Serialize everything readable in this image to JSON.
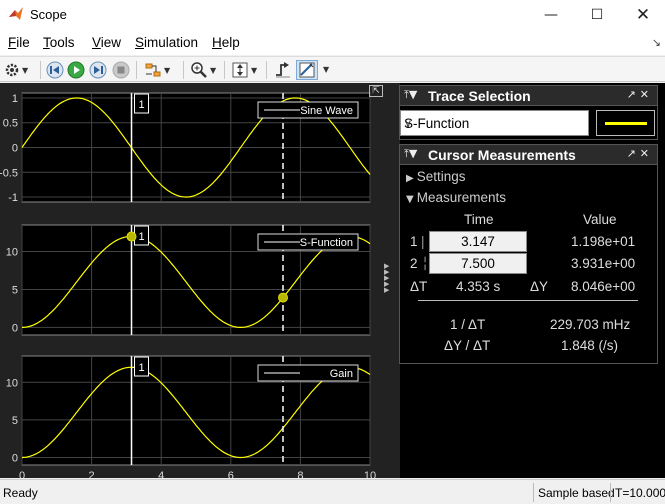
{
  "window": {
    "title": "Scope",
    "controls": [
      "minimize-icon",
      "maximize-icon",
      "close-icon"
    ]
  },
  "menu": {
    "items": [
      {
        "label": "File",
        "mnemonic": "F"
      },
      {
        "label": "Tools",
        "mnemonic": "T"
      },
      {
        "label": "View",
        "mnemonic": "V"
      },
      {
        "label": "Simulation",
        "mnemonic": "S"
      },
      {
        "label": "Help",
        "mnemonic": "H"
      }
    ]
  },
  "toolbar": {
    "buttons": [
      "settings-icon",
      "step-back-icon",
      "run-icon",
      "step-forward-icon",
      "stop-icon",
      "highlight-simulink-icon",
      "zoom-icon",
      "scale-axes-icon",
      "triggers-icon",
      "cursor-measurements-icon"
    ]
  },
  "plots": {
    "x_ticks": [
      "0",
      "2",
      "4",
      "6",
      "8",
      "10"
    ],
    "cursor1_label": "1",
    "panes": [
      {
        "legend": "Sine Wave",
        "y_ticks": [
          "1",
          "0.5",
          "0",
          "-0.5",
          "-1"
        ]
      },
      {
        "legend": "S-Function",
        "y_ticks": [
          "10",
          "5",
          "0"
        ]
      },
      {
        "legend": "Gain",
        "y_ticks": [
          "10",
          "5",
          "0"
        ]
      }
    ],
    "colors": {
      "trace": "#ffff00",
      "grid": "#444444",
      "axes_bg": "#000000",
      "figure_bg": "#222222"
    }
  },
  "chart_data": [
    {
      "type": "line",
      "title": "",
      "xlabel": "",
      "ylabel": "",
      "xlim": [
        0,
        10
      ],
      "ylim": [
        -1.1,
        1.1
      ],
      "series": [
        {
          "name": "Sine Wave",
          "function": "sin(t)",
          "x": [
            0,
            1.571,
            3.142,
            4.712,
            6.283,
            7.854,
            9.425,
            10
          ],
          "y": [
            0,
            1,
            0,
            -1,
            0,
            1,
            0,
            -0.544
          ]
        }
      ],
      "cursors": [
        3.147,
        7.5
      ]
    },
    {
      "type": "line",
      "title": "",
      "xlabel": "",
      "ylabel": "",
      "xlim": [
        0,
        10
      ],
      "ylim": [
        -1,
        13.5
      ],
      "series": [
        {
          "name": "S-Function",
          "function": "6*(1-cos(t))",
          "x": [
            0,
            1.571,
            3.142,
            4.712,
            6.283,
            7.854,
            9.425,
            10
          ],
          "y": [
            0,
            6,
            12,
            6,
            0,
            6,
            12,
            11.03
          ]
        }
      ],
      "cursors": [
        3.147,
        7.5
      ],
      "markers": [
        {
          "x": 3.147,
          "y": 11.98
        },
        {
          "x": 7.5,
          "y": 3.931
        }
      ]
    },
    {
      "type": "line",
      "title": "",
      "xlabel": "",
      "ylabel": "",
      "xlim": [
        0,
        10
      ],
      "ylim": [
        -1,
        13.5
      ],
      "series": [
        {
          "name": "Gain",
          "function": "6*(1-cos(t))",
          "x": [
            0,
            1.571,
            3.142,
            4.712,
            6.283,
            7.854,
            9.425,
            10
          ],
          "y": [
            0,
            6,
            12,
            6,
            0,
            6,
            12,
            11.03
          ]
        }
      ],
      "cursors": [
        3.147,
        7.5
      ]
    }
  ],
  "trace_selection": {
    "title": "Trace Selection",
    "selected": "S-Function",
    "swatch_color": "#ffff00"
  },
  "cursor_measurements": {
    "title": "Cursor Measurements",
    "settings_label": "Settings",
    "measurements_label": "Measurements",
    "col_time": "Time",
    "col_value": "Value",
    "row1_label": "1",
    "row1_time": "3.147",
    "row1_value": "1.198e+01",
    "row2_label": "2",
    "row2_time": "7.500",
    "row2_value": "3.931e+00",
    "dt_label": "ΔT",
    "dt_value": "4.353 s",
    "dy_label": "ΔY",
    "dy_value": "8.046e+00",
    "inv_dt_label": "1 / ΔT",
    "inv_dt_value": "229.703 mHz",
    "dy_dt_label": "ΔY / ΔT",
    "dy_dt_value": "1.848 (/s)"
  },
  "status": {
    "left": "Ready",
    "mode": "Sample based",
    "time": "T=10.000"
  }
}
